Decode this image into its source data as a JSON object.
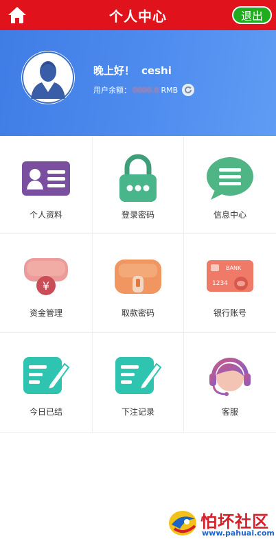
{
  "header": {
    "title": "个人中心",
    "logout_label": "退出",
    "home_icon": "home-icon",
    "bar_color": "#e0121b",
    "logout_color": "#1fad1f"
  },
  "profile": {
    "greeting": "晚上好！",
    "username": "ceshi",
    "balance_label": "用户余额：",
    "balance_value": "0000.0",
    "currency": "RMB",
    "banner_color": "#4a88ec"
  },
  "menu": [
    {
      "label": "个人资料",
      "icon": "id-card-icon"
    },
    {
      "label": "登录密码",
      "icon": "padlock-icon"
    },
    {
      "label": "信息中心",
      "icon": "chat-bubble-icon"
    },
    {
      "label": "资金管理",
      "icon": "money-bag-icon"
    },
    {
      "label": "取款密码",
      "icon": "wallet-icon"
    },
    {
      "label": "银行账号",
      "icon": "bank-card-icon"
    },
    {
      "label": "今日已结",
      "icon": "edit-note-icon"
    },
    {
      "label": "下注记录",
      "icon": "edit-note-icon"
    },
    {
      "label": "客服",
      "icon": "customer-service-icon"
    }
  ],
  "watermark": {
    "text": "怕坏社区",
    "url": "www.pahuai.com"
  }
}
